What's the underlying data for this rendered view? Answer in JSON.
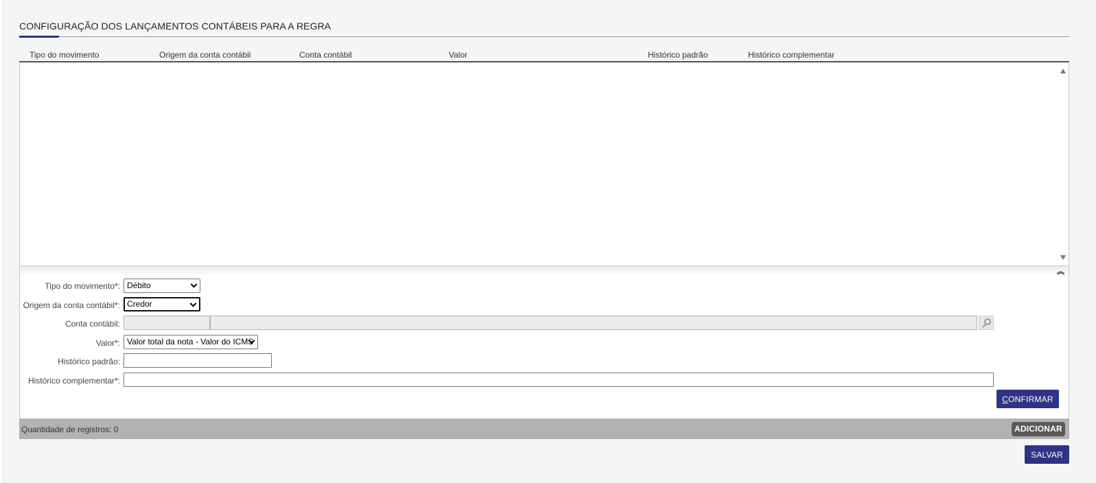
{
  "section": {
    "title": "CONFIGURAÇÃO DOS LANÇAMENTOS CONTÁBEIS PARA A REGRA"
  },
  "grid": {
    "columns": [
      "Tipo do movimento",
      "Origem da conta contábil",
      "Conta contábil",
      "Valor",
      "Histórico padrão",
      "Histórico complementar"
    ],
    "rows": []
  },
  "form": {
    "tipo_movimento": {
      "label": "Tipo do movimento*:",
      "value": "Débito"
    },
    "origem_conta": {
      "label": "Origem da conta contábil*:",
      "value": "Credor"
    },
    "conta_contabil": {
      "label": "Conta contábil:",
      "code": "",
      "description": ""
    },
    "valor": {
      "label": "Valor*:",
      "value": "Valor total da nota - Valor do ICMS"
    },
    "historico_padrao": {
      "label": "Histórico padrão:",
      "value": ""
    },
    "historico_complementar": {
      "label": "Histórico complementar*:",
      "value": ""
    },
    "confirm_label_first": "C",
    "confirm_label_rest": "ONFIRMAR"
  },
  "footer": {
    "record_count_label": "Quantidade de registros: 0",
    "add_label": "ADICIONAR"
  },
  "save_label": "SALVAR",
  "icons": {
    "lookup": "search-icon",
    "collapse": "double-chevron-up-icon",
    "scroll_up": "arrow-up-icon",
    "scroll_down": "arrow-down-icon"
  },
  "colors": {
    "primary": "#2e3383",
    "footer_bar": "#b2b2b2",
    "add_button": "#5a5a5a"
  }
}
